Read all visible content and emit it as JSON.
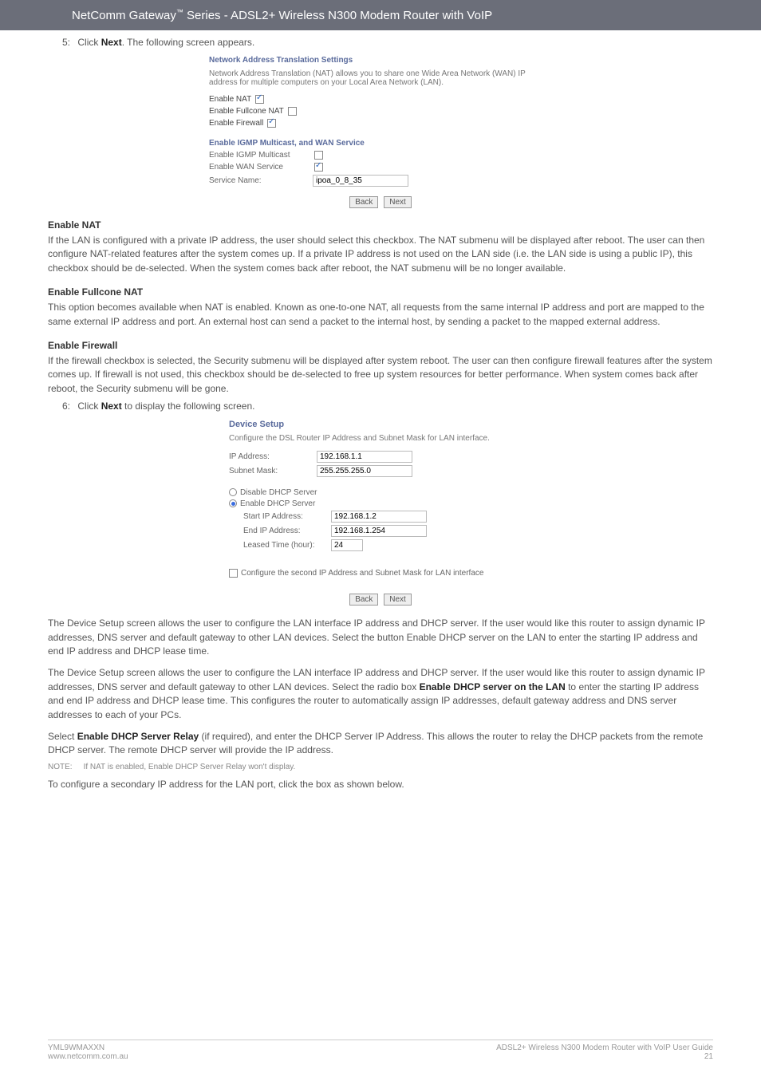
{
  "header": {
    "title_prefix": "NetComm Gateway",
    "title_suffix": " Series - ADSL2+ Wireless N300 Modem Router with VoIP"
  },
  "step5": {
    "num": "5:",
    "pre": "Click ",
    "bold": "Next",
    "post": ". The following screen appears."
  },
  "shot1": {
    "title": "Network Address Translation Settings",
    "desc": "Network Address Translation (NAT) allows you to share one Wide Area Network (WAN) IP address for multiple computers on your Local Area Network (LAN).",
    "enable_nat": "Enable NAT",
    "enable_full": "Enable Fullcone NAT",
    "enable_fw": "Enable Firewall",
    "sub": "Enable IGMP Multicast, and WAN Service",
    "igmp_label": "Enable IGMP Multicast",
    "wan_label": "Enable WAN Service",
    "svc_label": "Service Name:",
    "svc_value": "ipoa_0_8_35",
    "back": "Back",
    "next": "Next"
  },
  "sec_enable_nat": {
    "head": "Enable NAT",
    "body": "If the LAN is configured with a private IP address, the user should select this checkbox. The NAT submenu will be displayed after reboot. The user can then configure NAT-related features after the system comes up. If a private IP address is not used on the LAN side (i.e. the LAN side is using a public IP), this checkbox should be de-selected. When the system comes back after reboot, the NAT submenu will be no longer available."
  },
  "sec_fullcone": {
    "head": "Enable Fullcone NAT",
    "body": "This option becomes available when NAT is enabled.  Known as one-to-one NAT, all requests from the same internal IP address and port are mapped to the same external IP address and port. An external host can send a packet to the internal host, by sending a packet to the mapped external address."
  },
  "sec_firewall": {
    "head": "Enable Firewall",
    "body": "If the firewall checkbox is selected, the Security submenu will be displayed after system reboot. The user can then configure firewall features after the system comes up. If firewall is not used, this checkbox should be de-selected to free up system resources for better performance. When system comes back after reboot, the Security submenu will be gone."
  },
  "step6": {
    "num": "6:",
    "pre": "Click ",
    "bold": "Next",
    "post": " to display the following screen."
  },
  "shot2": {
    "title": "Device Setup",
    "desc": "Configure the DSL Router IP Address and Subnet Mask for LAN interface.",
    "ip_label": "IP Address:",
    "ip_value": "192.168.1.1",
    "mask_label": "Subnet Mask:",
    "mask_value": "255.255.255.0",
    "disable_dhcp": "Disable DHCP Server",
    "enable_dhcp": "Enable DHCP Server",
    "start_label": "Start IP Address:",
    "start_value": "192.168.1.2",
    "end_label": "End IP Address:",
    "end_value": "192.168.1.254",
    "lease_label": "Leased Time (hour):",
    "lease_value": "24",
    "cfg2": "Configure the second IP Address and Subnet Mask for LAN interface",
    "back": "Back",
    "next": "Next"
  },
  "para1": "The Device Setup screen allows the user to configure the LAN interface IP address and DHCP server. If the user would like this router to assign dynamic IP addresses, DNS server and default gateway to other LAN devices. Select the button Enable DHCP server on the LAN to enter the starting IP address and end IP address and DHCP lease time.",
  "para2_pre": "The Device Setup screen allows the user to configure the LAN interface IP address and DHCP server. If the user would like this router to assign dynamic IP addresses, DNS server and default gateway to other LAN devices. Select the radio box ",
  "para2_bold1": "Enable DHCP server on the LAN",
  "para2_post": " to enter the starting IP address and end IP address and DHCP lease time. This configures the router to automatically assign IP addresses, default gateway address and DNS server addresses to each of your PCs.",
  "para3_pre": "Select ",
  "para3_bold": "Enable DHCP Server Relay",
  "para3_post": " (if required), and enter the DHCP Server IP Address. This allows the router to relay the DHCP packets from the remote DHCP server. The remote DHCP server will provide the IP address.",
  "note": {
    "label": "NOTE:",
    "text": "If NAT is enabled, Enable DHCP Server Relay won't display."
  },
  "para4": "To configure a secondary IP address for the LAN port, click the box as shown below.",
  "footer": {
    "left1": "YML9WMAXXN",
    "left2": "www.netcomm.com.au",
    "right1": "ADSL2+ Wireless N300 Modem Router with VoIP User Guide",
    "right2": "21"
  }
}
